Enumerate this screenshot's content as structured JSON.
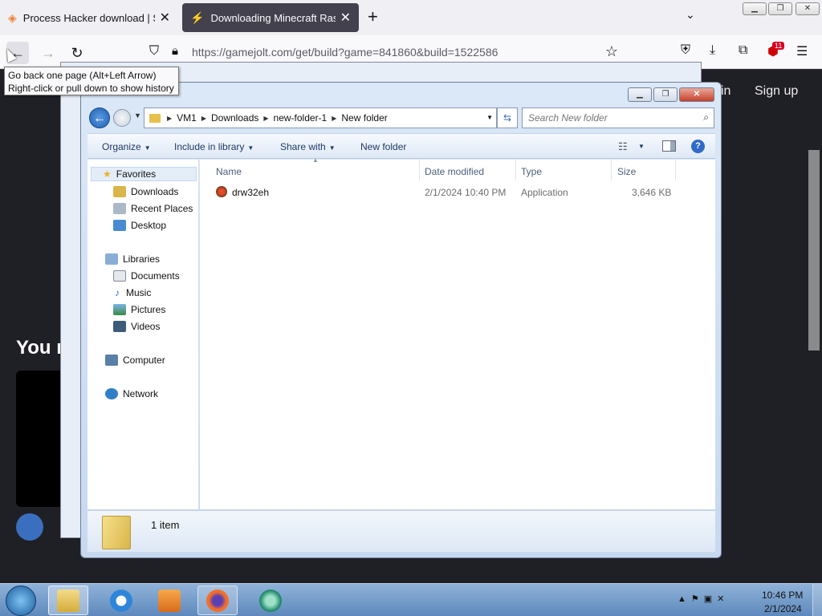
{
  "browser": {
    "tabs": [
      {
        "title": "Process Hacker download | Sou",
        "active": false
      },
      {
        "title": "Downloading Minecraft Raspbe",
        "active": true
      }
    ],
    "url": "https://gamejolt.com/get/build?game=841860&build=1522586",
    "tooltip_line1": "Go back one page (Alt+Left Arrow)",
    "tooltip_line2": "Right-click or pull down to show history",
    "extension_badge": "11"
  },
  "webpage": {
    "signin": "in",
    "signup": "Sign up",
    "heading_fragment": "You r"
  },
  "explorer": {
    "breadcrumb": [
      "VM1",
      "Downloads",
      "new-folder-1",
      "New folder"
    ],
    "search_placeholder": "Search New folder",
    "toolbar": {
      "organize": "Organize",
      "include_library": "Include in library",
      "share_with": "Share with",
      "new_folder": "New folder"
    },
    "nav": {
      "favorites": "Favorites",
      "downloads": "Downloads",
      "recent_places": "Recent Places",
      "desktop": "Desktop",
      "libraries": "Libraries",
      "documents": "Documents",
      "music": "Music",
      "pictures": "Pictures",
      "videos": "Videos",
      "computer": "Computer",
      "network": "Network"
    },
    "columns": {
      "name": "Name",
      "date": "Date modified",
      "type": "Type",
      "size": "Size"
    },
    "files": [
      {
        "name": "drw32eh",
        "date": "2/1/2024 10:40 PM",
        "type": "Application",
        "size": "3,646 KB"
      }
    ],
    "status": "1 item"
  },
  "taskbar": {
    "time": "10:46 PM",
    "date": "2/1/2024"
  },
  "colors": {
    "firefox_active_tab": "#42414d",
    "explorer_frame": "#c7d9ef",
    "taskbar": "#5e89bd"
  }
}
